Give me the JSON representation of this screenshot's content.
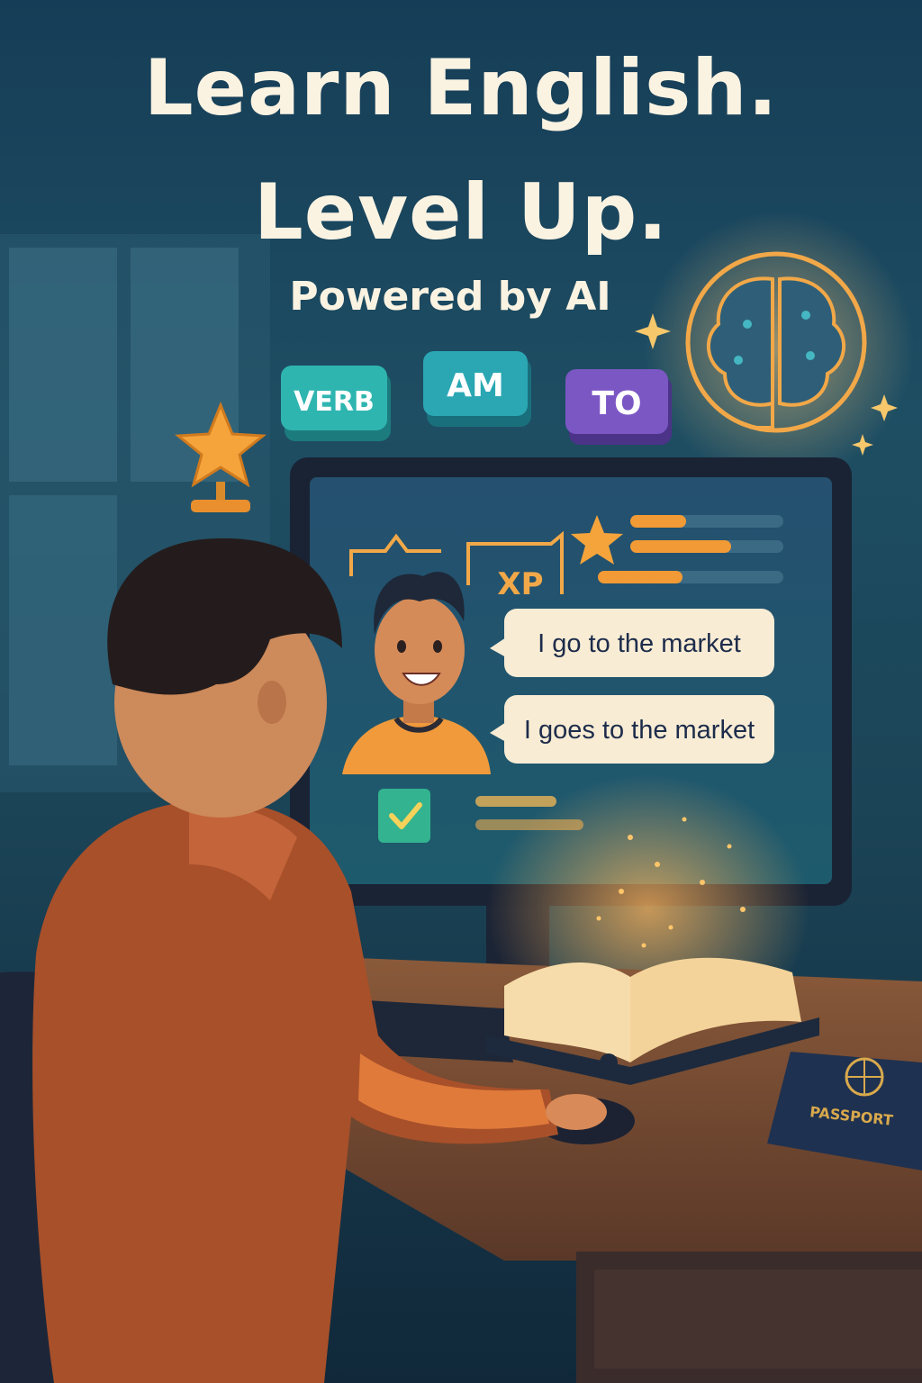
{
  "poster": {
    "headline_line1": "Learn English.",
    "headline_line2": "Level Up.",
    "tagline": "Powered by AI"
  },
  "word_tiles": [
    {
      "label": "VERB",
      "color": "#2fb5b0"
    },
    {
      "label": "AM",
      "color": "#2aa7b3"
    },
    {
      "label": "TO",
      "color": "#7b57c4"
    }
  ],
  "screen": {
    "xp_label": "XP",
    "correct_sentence": "I go to the market",
    "incorrect_sentence": "I goes to the market"
  },
  "desk": {
    "passport_label": "PASSPORT"
  },
  "colors": {
    "accent_orange": "#f29a35",
    "cream_text": "#fbf3e2",
    "background_teal": "#1e4e63"
  }
}
